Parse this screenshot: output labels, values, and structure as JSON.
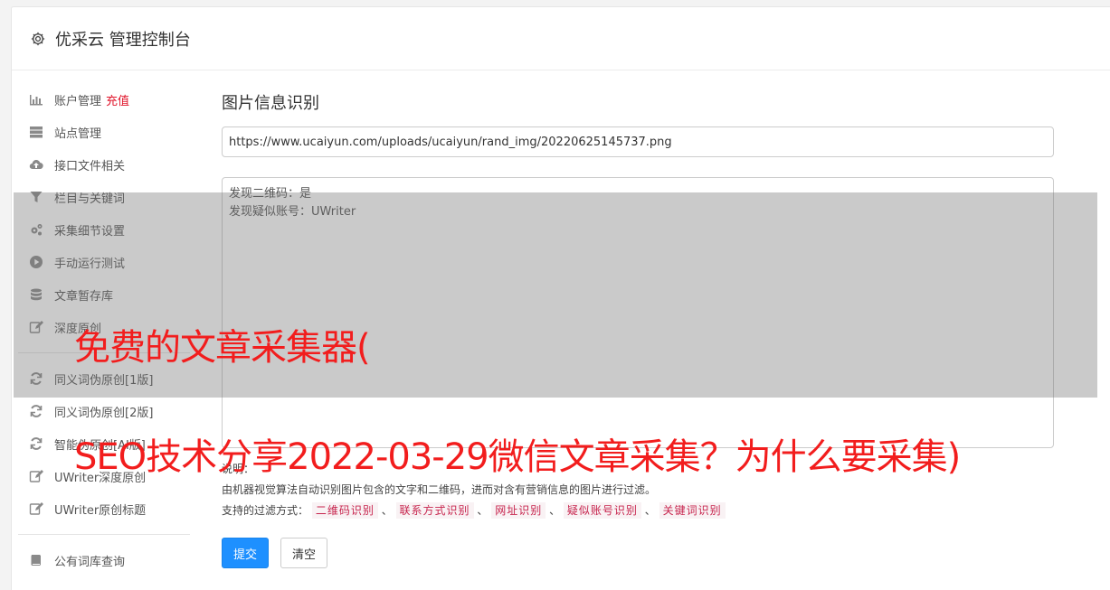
{
  "header": {
    "icon": "gear-icon",
    "title": "优采云 管理控制台"
  },
  "sidebar": {
    "items": [
      {
        "icon": "bar-chart-icon",
        "label": "账户管理",
        "extra": "充值"
      },
      {
        "icon": "server-icon",
        "label": "站点管理"
      },
      {
        "icon": "cloud-upload-icon",
        "label": "接口文件相关"
      },
      {
        "icon": "filter-icon",
        "label": "栏目与关键词"
      },
      {
        "icon": "gears-icon",
        "label": "采集细节设置"
      },
      {
        "icon": "play-circle-icon",
        "label": "手动运行测试"
      },
      {
        "icon": "database-icon",
        "label": "文章暂存库"
      },
      {
        "icon": "edit-icon",
        "label": "深度原创"
      },
      {
        "icon": "refresh-icon",
        "label": "同义词伪原创[1版]"
      },
      {
        "icon": "refresh-icon",
        "label": "同义词伪原创[2版]"
      },
      {
        "icon": "refresh-icon",
        "label": "智能伪原创[AI版]"
      },
      {
        "icon": "edit-icon",
        "label": "UWriter深度原创"
      },
      {
        "icon": "edit-icon",
        "label": "UWriter原创标题"
      },
      {
        "icon": "book-icon",
        "label": "公有词库查询"
      }
    ]
  },
  "main": {
    "title": "图片信息识别",
    "url_value": "https://www.ucaiyun.com/uploads/ucaiyun/rand_img/20220625145737.png",
    "result_lines": [
      "发现二维码：是",
      "发现疑似账号：UWriter"
    ],
    "desc_label": "说明：",
    "desc_text": "由机器视觉算法自动识别图片包含的文字和二维码，进而对含有营销信息的图片进行过滤。",
    "filter_label": "支持的过滤方式：",
    "filter_sep": "、",
    "filters": [
      "二维码识别",
      "联系方式识别",
      "网址识别",
      "疑似账号识别",
      "关键词识别"
    ],
    "submit_label": "提交",
    "clear_label": "清空"
  },
  "watermark": {
    "line1": "免费的文章采集器(",
    "line2": "SEO技术分享2022-03-29微信文章采集？为什么要采集)",
    "color": "#f21d1d"
  }
}
